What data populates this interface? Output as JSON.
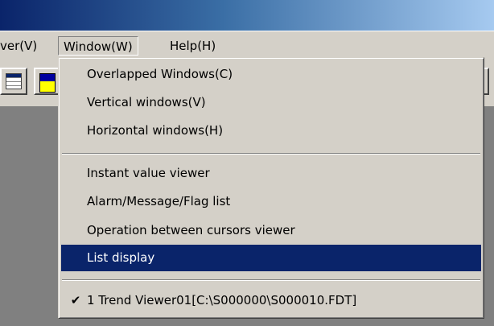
{
  "menubar": {
    "items": [
      {
        "label": "ver(V)"
      },
      {
        "label": "Window(W)"
      },
      {
        "label": "Help(H)"
      }
    ]
  },
  "window_menu": {
    "group1": [
      "Overlapped Windows(C)",
      "Vertical windows(V)",
      "Horizontal windows(H)"
    ],
    "group2": [
      "Instant value viewer",
      "Alarm/Message/Flag list",
      "Operation between cursors viewer",
      "List display"
    ],
    "group3": [
      {
        "check": "✔",
        "label": "1 Trend Viewer01[C:\\S000000\\S000010.FDT]"
      }
    ],
    "highlighted": "List display"
  },
  "colors": {
    "highlight": "#0a246a",
    "face": "#d4d0c8",
    "workspace": "#808080"
  },
  "icons": [
    "table-view-icon",
    "color-settings-icon"
  ]
}
